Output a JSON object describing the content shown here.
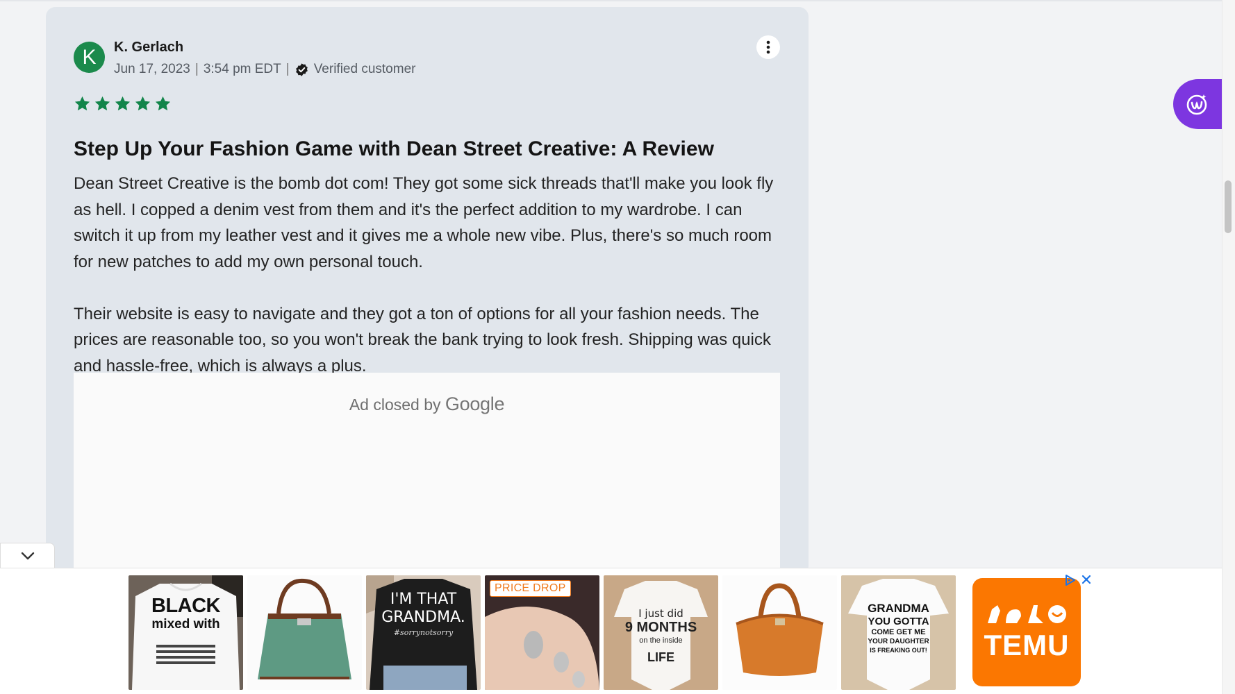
{
  "review": {
    "avatar_letter": "K",
    "author": "K. Gerlach",
    "date": "Jun 17, 2023",
    "time": "3:54 pm EDT",
    "separator": "|",
    "verified_label": "Verified customer",
    "rating": 5,
    "title": "Step Up Your Fashion Game with Dean Street Creative: A Review",
    "paragraphs": [
      "Dean Street Creative is the bomb dot com! They got some sick threads that'll make you look fly as hell. I copped a denim vest from them and it's the perfect addition to my wardrobe. I can switch it up from my leather vest and it gives me a whole new vibe. Plus, there's so much room for new patches to add my own personal touch.",
      "Their website is easy to navigate and they got a ton of options for all your fashion needs. The prices are reasonable too, so you won't break the bank trying to look fresh. Shipping was quick and hassle-free, which is always a plus."
    ]
  },
  "ad_slot": {
    "closed_by": "Ad closed by",
    "google": "Google"
  },
  "bottom_ad": {
    "products": [
      {
        "name": "black-mixed-with-shirt",
        "text_main": "BLACK",
        "text_sub": "mixed with"
      },
      {
        "name": "green-handbag"
      },
      {
        "name": "grandma-shirt",
        "text_main": "I'M THAT",
        "text_sub": "GRANDMA.",
        "text_tag": "#sorrynotsorry"
      },
      {
        "name": "toe-rings",
        "badge": "PRICE DROP"
      },
      {
        "name": "nine-months-onesie",
        "text_a": "I just did",
        "text_b": "9 MONTHS",
        "text_c": "on the inside",
        "text_d": "LIFE"
      },
      {
        "name": "orange-croc-bag"
      },
      {
        "name": "grandma-onesie",
        "text_a": "GRANDMA",
        "text_b": "YOU GOTTA",
        "text_c": "COME GET ME",
        "text_d": "YOUR DAUGHTER",
        "text_e": "IS FREAKING OUT!"
      }
    ],
    "brand": "TEMU"
  },
  "colors": {
    "card_bg": "#e1e6ec",
    "avatar_green": "#1b8a4c",
    "star_green": "#12854a",
    "temu_orange": "#fb7701",
    "badge_purple": "#7d36e0"
  }
}
